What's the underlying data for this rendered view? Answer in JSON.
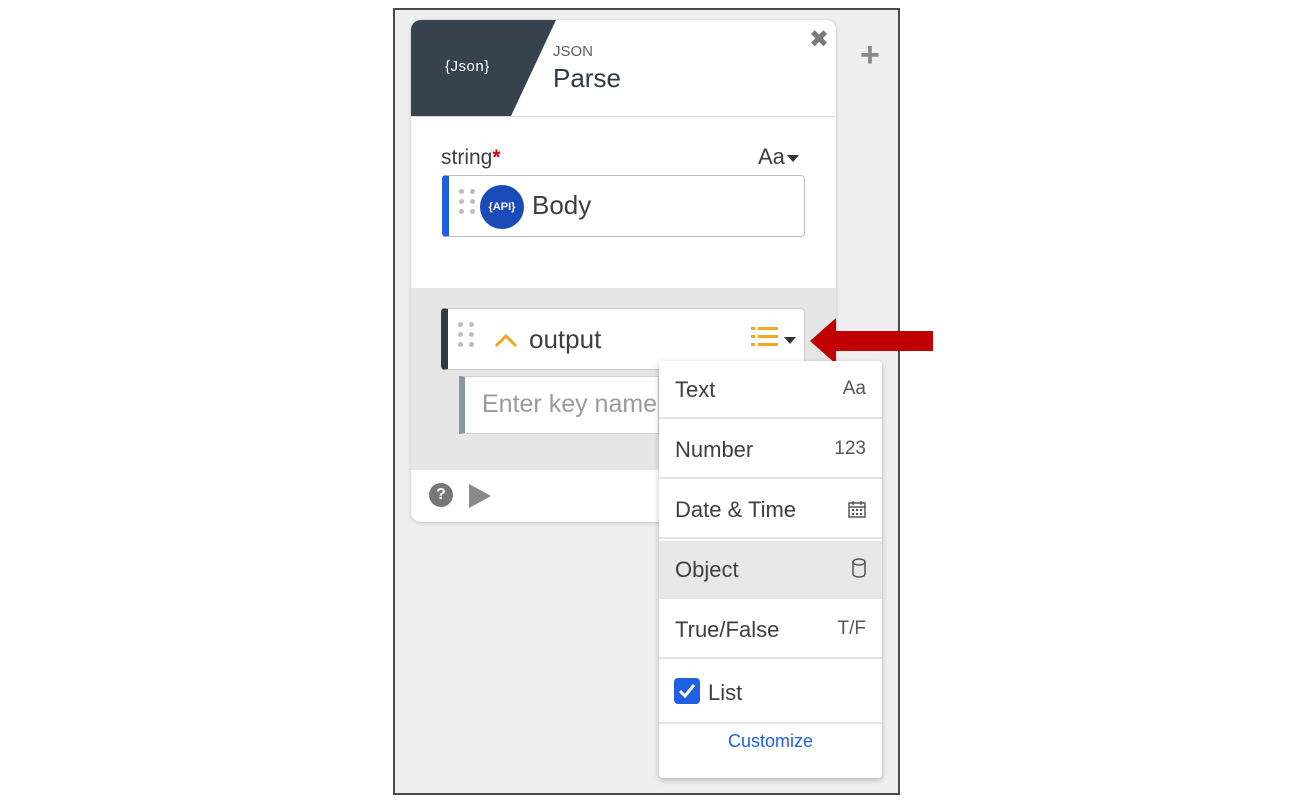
{
  "card": {
    "logo_text": "{Json}",
    "category": "JSON",
    "title": "Parse",
    "close_symbol": "✖"
  },
  "input_field": {
    "label": "string",
    "required_mark": "*",
    "type_label": "Aa",
    "value": "Body",
    "source_badge": "{API}"
  },
  "output_field": {
    "name": "output",
    "key_placeholder": "Enter key name"
  },
  "footer": {
    "help_symbol": "?"
  },
  "add_symbol": "+",
  "type_menu": {
    "items": [
      {
        "label": "Text",
        "icon_text": "Aa",
        "icon": "text-type-icon",
        "selected": false
      },
      {
        "label": "Number",
        "icon_text": "123",
        "icon": "number-type-icon",
        "selected": false
      },
      {
        "label": "Date & Time",
        "icon_text": "📅",
        "icon": "calendar-icon",
        "selected": false
      },
      {
        "label": "Object",
        "icon_text": "⛁",
        "icon": "object-cylinder-icon",
        "selected": true
      },
      {
        "label": "True/False",
        "icon_text": "T/F",
        "icon": "boolean-type-icon",
        "selected": false
      }
    ],
    "list_label": "List",
    "list_checked": true,
    "customize_label": "Customize"
  },
  "colors": {
    "header_badge": "#36424d",
    "accent_blue": "#1f5fe0",
    "required_red": "#d0021b",
    "orange": "#f5a623",
    "arrow_red": "#c00000"
  }
}
